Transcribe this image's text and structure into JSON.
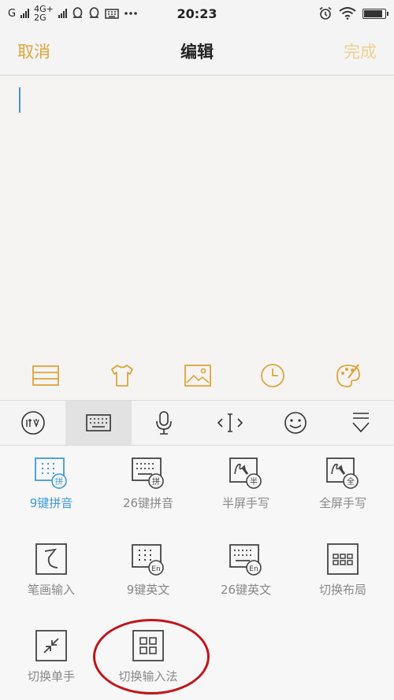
{
  "status_bar": {
    "carrier_g": "G",
    "net_4g": "4G+",
    "net_2g": "2G",
    "time": "20:23"
  },
  "nav": {
    "cancel_label": "取消",
    "title": "编辑",
    "done_label": "完成"
  },
  "colors": {
    "accent": "#e0a43a",
    "accent_disabled": "#f1cf8f",
    "selected_blue": "#3d9ad8",
    "highlight_red": "#c0151b"
  },
  "tool_bar_icons": [
    "list-icon",
    "tshirt-icon",
    "image-icon",
    "clock-icon",
    "palette-icon"
  ],
  "keyboard_toolbar_icons": [
    "handwriting-mode-icon",
    "keyboard-icon",
    "microphone-icon",
    "cursor-move-icon",
    "emoji-icon",
    "collapse-keyboard-icon"
  ],
  "keyboard_options": [
    {
      "label": "9键拼音",
      "icon": "nine-key-pinyin-icon",
      "badge": "拼",
      "selected": true
    },
    {
      "label": "26键拼音",
      "icon": "qwerty-pinyin-icon",
      "badge": "拼",
      "selected": false
    },
    {
      "label": "半屏手写",
      "icon": "half-screen-handwriting-icon",
      "badge": "半",
      "selected": false
    },
    {
      "label": "全屏手写",
      "icon": "full-screen-handwriting-icon",
      "badge": "全",
      "selected": false
    },
    {
      "label": "笔画输入",
      "icon": "stroke-input-icon",
      "badge": "",
      "selected": false
    },
    {
      "label": "9键英文",
      "icon": "nine-key-english-icon",
      "badge": "En",
      "selected": false
    },
    {
      "label": "26键英文",
      "icon": "qwerty-english-icon",
      "badge": "En",
      "selected": false
    },
    {
      "label": "切换布局",
      "icon": "switch-layout-icon",
      "badge": "",
      "selected": false
    },
    {
      "label": "切换单手",
      "icon": "one-hand-mode-icon",
      "badge": "",
      "selected": false
    },
    {
      "label": "切换输入法",
      "icon": "switch-input-method-icon",
      "badge": "",
      "selected": false
    }
  ]
}
